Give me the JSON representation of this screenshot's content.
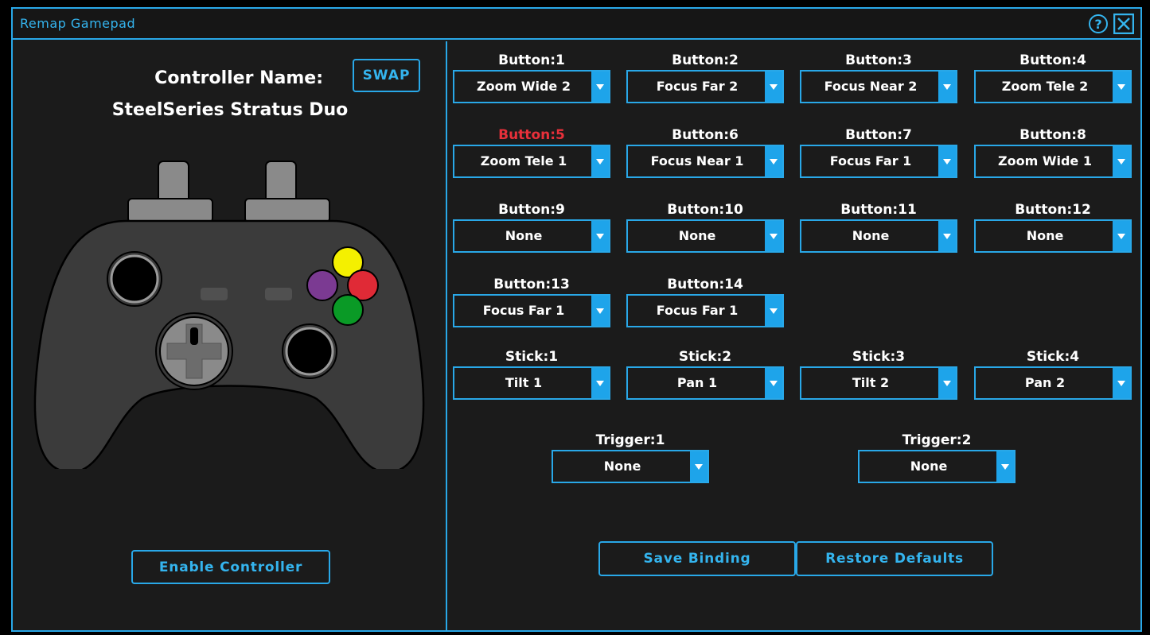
{
  "window": {
    "title": "Remap Gamepad",
    "help_glyph": "?"
  },
  "left": {
    "controller_label": "Controller Name:",
    "swap_label": "SWAP",
    "controller_name": "SteelSeries Stratus Duo",
    "enable_label": "Enable Controller",
    "gamepad_icon": "gamepad-illustration",
    "face_button_colors": {
      "top": "#f4f000",
      "right": "#e02a36",
      "bottom": "#0a9a26",
      "left": "#7b3a92"
    }
  },
  "bindings": {
    "buttons": [
      {
        "label": "Button:1",
        "value": "Zoom Wide 2"
      },
      {
        "label": "Button:2",
        "value": "Focus Far 2"
      },
      {
        "label": "Button:3",
        "value": "Focus Near 2"
      },
      {
        "label": "Button:4",
        "value": "Zoom Tele 2"
      },
      {
        "label": "Button:5",
        "value": "Zoom Tele 1",
        "highlighted": true
      },
      {
        "label": "Button:6",
        "value": "Focus Near 1"
      },
      {
        "label": "Button:7",
        "value": "Focus Far 1"
      },
      {
        "label": "Button:8",
        "value": "Zoom Wide 1"
      },
      {
        "label": "Button:9",
        "value": "None"
      },
      {
        "label": "Button:10",
        "value": "None"
      },
      {
        "label": "Button:11",
        "value": "None"
      },
      {
        "label": "Button:12",
        "value": "None"
      },
      {
        "label": "Button:13",
        "value": "Focus Far 1"
      },
      {
        "label": "Button:14",
        "value": "Focus Far 1"
      }
    ],
    "sticks": [
      {
        "label": "Stick:1",
        "value": "Tilt 1"
      },
      {
        "label": "Stick:2",
        "value": "Pan 1"
      },
      {
        "label": "Stick:3",
        "value": "Tilt 2"
      },
      {
        "label": "Stick:4",
        "value": "Pan 2"
      }
    ],
    "triggers": [
      {
        "label": "Trigger:1",
        "value": "None"
      },
      {
        "label": "Trigger:2",
        "value": "None"
      }
    ]
  },
  "actions": {
    "save_label": "Save Binding",
    "restore_label": "Restore Defaults"
  },
  "colors": {
    "accent": "#29a8e8",
    "highlight_label": "#e8303a"
  }
}
